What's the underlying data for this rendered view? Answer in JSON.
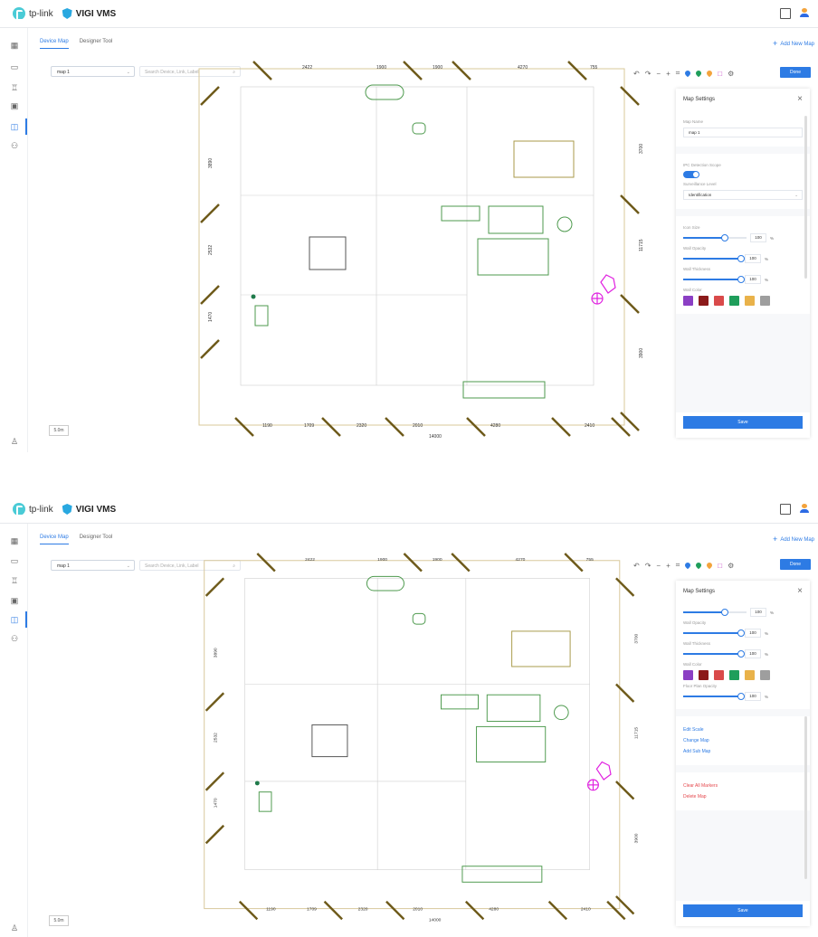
{
  "app": {
    "brand": "tp-link",
    "product": "VIGI VMS"
  },
  "tabs": [
    {
      "label": "Device Map"
    },
    {
      "label": "Designer Tool"
    }
  ],
  "add_map": "Add New Map",
  "map_select": "map 1",
  "search_placeholder": "Search Device, Link, Label",
  "done": "Done",
  "scale_label": "5.0m",
  "dimensions": {
    "top": [
      "2422",
      "1900",
      "1900",
      "4270",
      "755"
    ],
    "bottom": [
      "1190",
      "1709",
      "2320",
      "2010",
      "4280",
      "2410"
    ],
    "bottom_total": "14000",
    "left": [
      "3890",
      "2532",
      "1470"
    ],
    "right": [
      "3700",
      "11715",
      "3900"
    ]
  },
  "panel": {
    "title": "Map Settings",
    "map_name_label": "Map Name",
    "map_name_value": "map 1",
    "ipc_label": "IPC Detection Scope",
    "surveillance_label": "Surveillance Level",
    "surveillance_value": "Identification",
    "icon_size_label": "Icon Size",
    "icon_size_value": "100",
    "wall_opacity_label": "Wall Opacity",
    "wall_opacity_value": "100",
    "wall_thickness_label": "Wall Thickness",
    "wall_thickness_value": "100",
    "wall_color_label": "Wall Color",
    "floor_plan_opacity_label": "Floor Plan Opacity",
    "floor_plan_opacity_value": "100",
    "percent": "%",
    "edit_scale": "Edit Scale",
    "change_map": "Change Map",
    "add_sub_map": "Add Sub Map",
    "clear_markers": "Clear All Markers",
    "delete_map": "Delete Map",
    "save": "Save",
    "colors": [
      "#8b3fc4",
      "#8b1a1a",
      "#d94a4a",
      "#1f9e5b",
      "#e9b24a",
      "#9e9e9e"
    ]
  }
}
